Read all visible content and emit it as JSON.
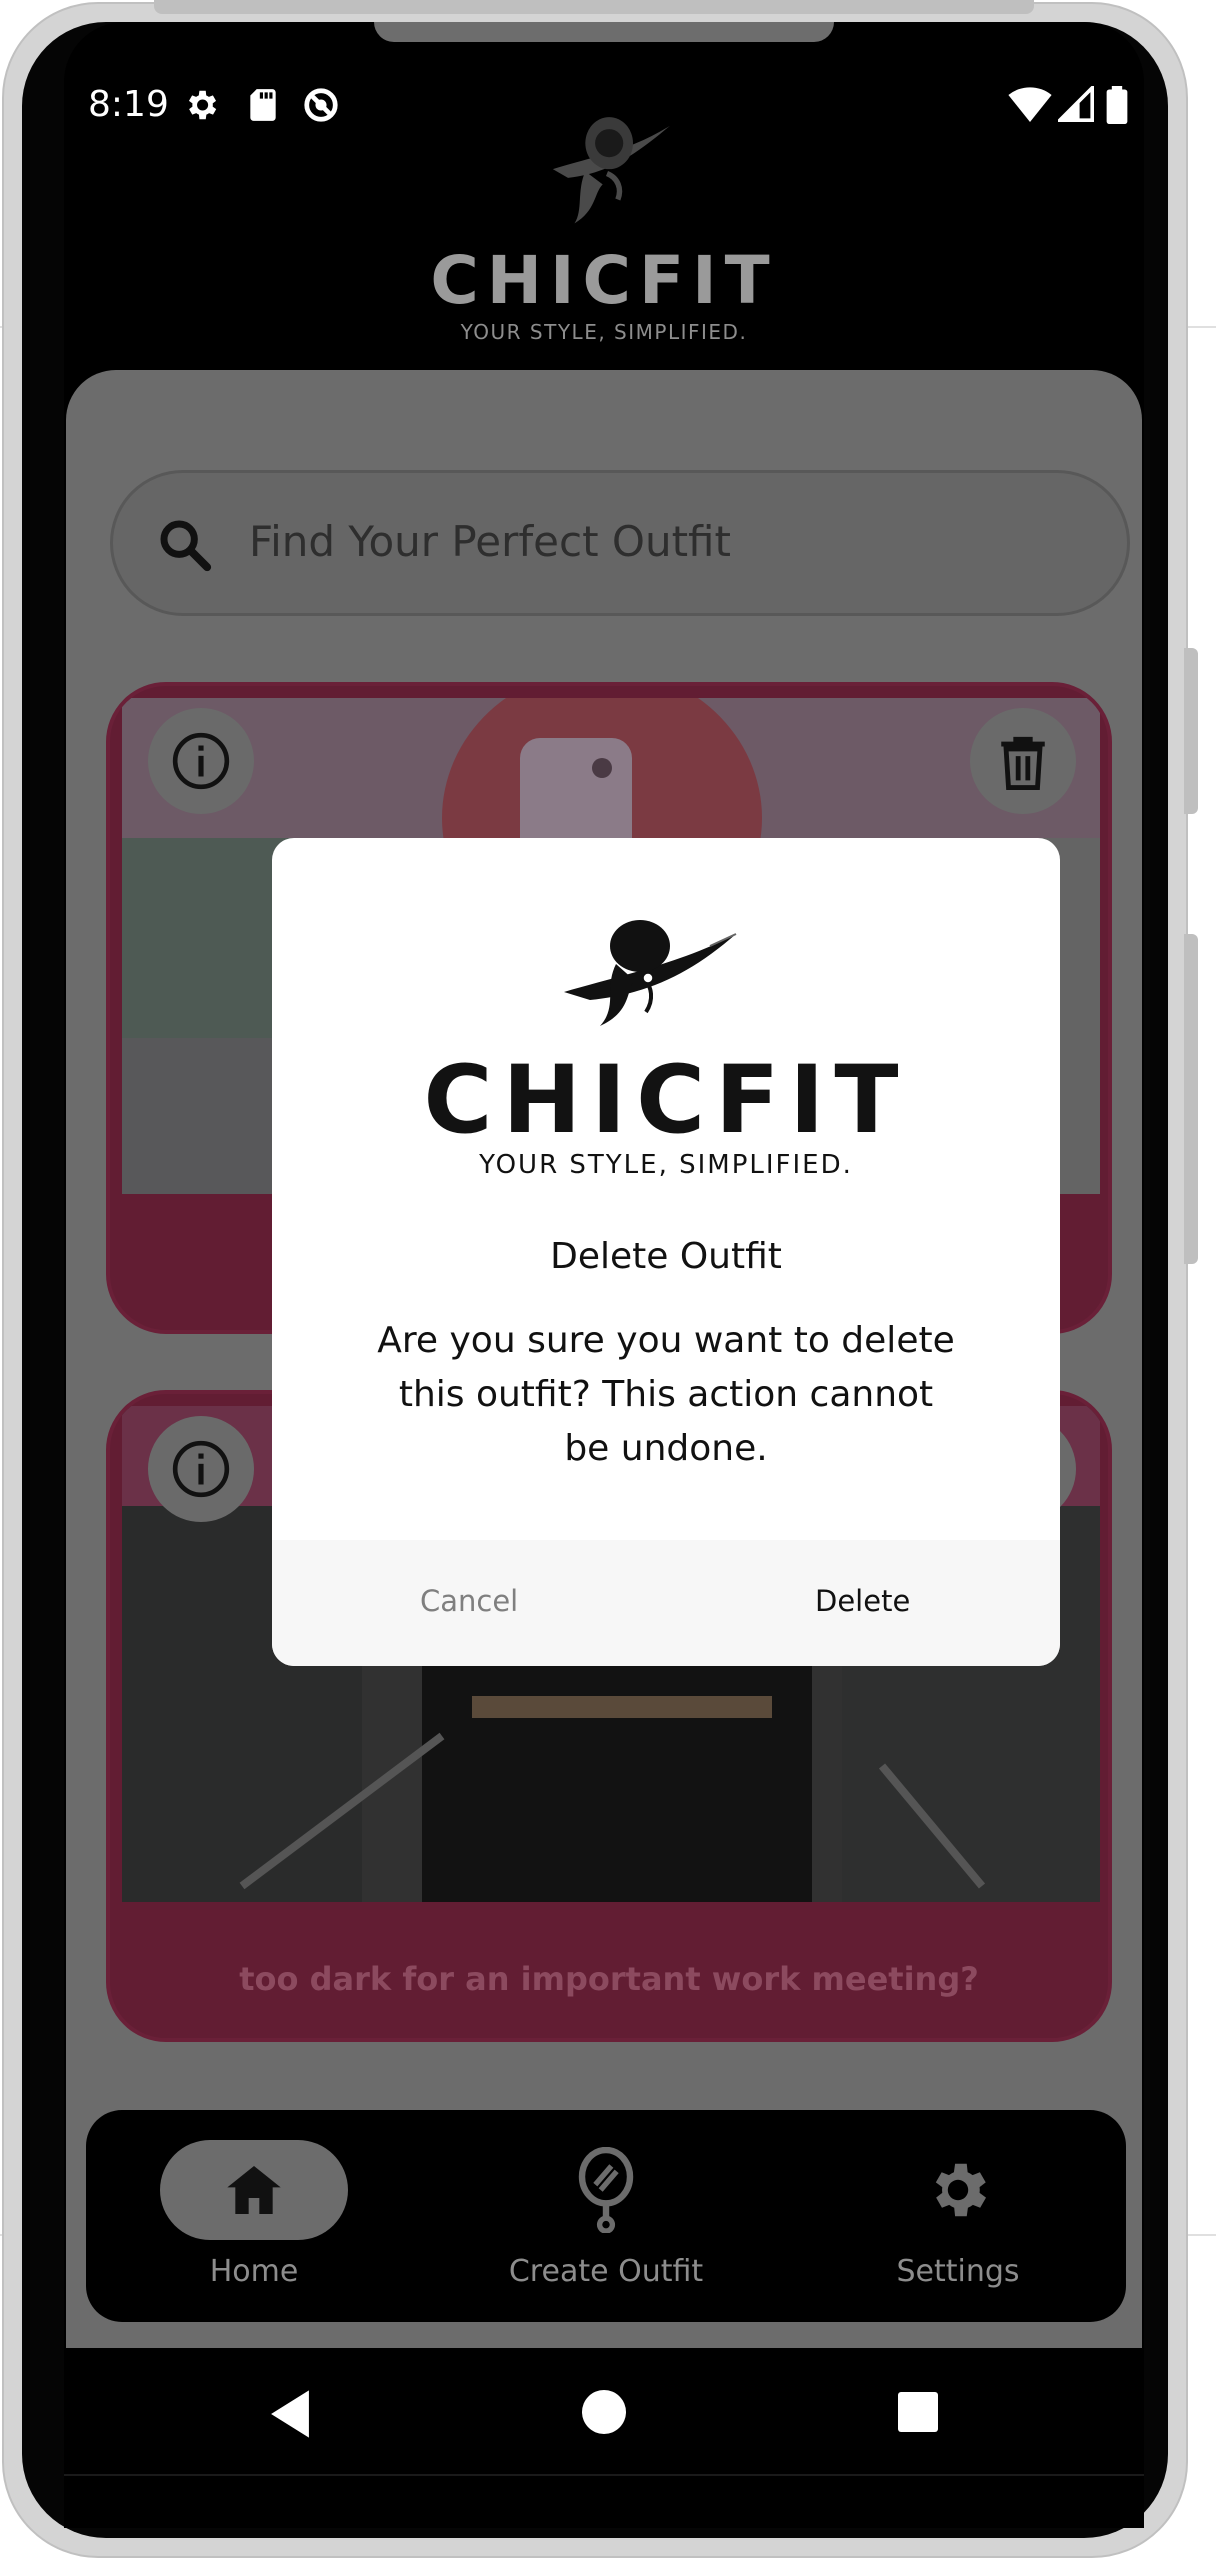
{
  "status_bar": {
    "time": "8:19",
    "left_icons": [
      "gear-icon",
      "sd-card-icon",
      "no-sync-icon"
    ],
    "right_icons": [
      "wifi-icon",
      "signal-icon",
      "battery-icon"
    ]
  },
  "header": {
    "brand": "CHICFIT",
    "tagline": "YOUR STYLE, SIMPLIFIED."
  },
  "search": {
    "placeholder": "Find Your Perfect Outfit"
  },
  "outfits": [
    {
      "caption": ""
    },
    {
      "caption": "too dark for an important work meeting?"
    }
  ],
  "bottom_nav": {
    "items": [
      {
        "label": "Home",
        "icon": "home-icon",
        "active": true
      },
      {
        "label": "Create Outfit",
        "icon": "mirror-icon",
        "active": false
      },
      {
        "label": "Settings",
        "icon": "gear-icon",
        "active": false
      }
    ]
  },
  "dialog": {
    "brand": "CHICFIT",
    "tagline": "YOUR STYLE, SIMPLIFIED.",
    "title": "Delete Outfit",
    "message": "Are you sure you want to delete this outfit? This action cannot be undone.",
    "cancel_label": "Cancel",
    "delete_label": "Delete"
  },
  "colors": {
    "card_background": "#621d33",
    "overlay_gray": "#6c6c6c",
    "dialog_background": "#ffffff"
  }
}
